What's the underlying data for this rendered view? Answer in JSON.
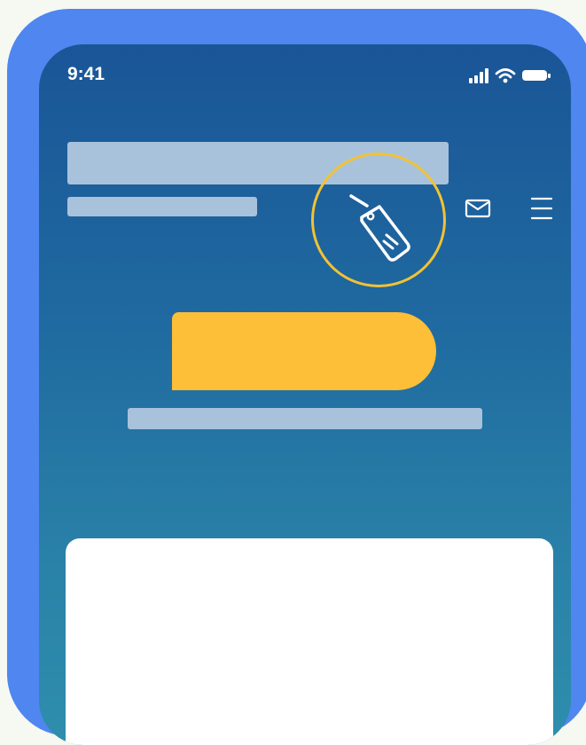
{
  "status_bar": {
    "time": "9:41",
    "icons": [
      "signal-icon",
      "wifi-icon",
      "battery-icon"
    ]
  },
  "header": {
    "icons": [
      "mail-icon",
      "menu-icon"
    ],
    "highlighted_icon": "price-tag-icon"
  },
  "colors": {
    "frame": "#4f86f0",
    "screen_top": "#1a5597",
    "screen_bottom": "#2e8eac",
    "placeholder": "#a9c2dc",
    "cta": "#fdbe38",
    "highlight_ring": "#f2c234",
    "card": "#ffffff"
  }
}
